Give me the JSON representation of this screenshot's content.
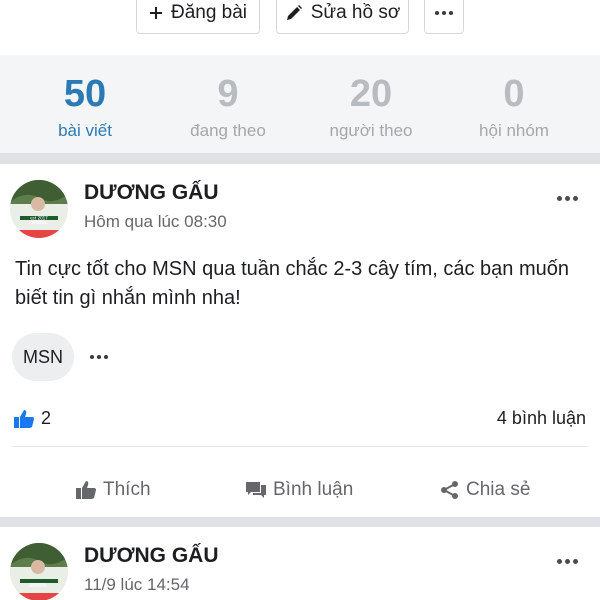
{
  "toolbar": {
    "post_label": "Đăng bài",
    "edit_label": "Sửa hồ sơ"
  },
  "stats": [
    {
      "value": "50",
      "label": "bài viết",
      "active": true
    },
    {
      "value": "9",
      "label": "đang theo",
      "active": false
    },
    {
      "value": "20",
      "label": "người theo",
      "active": false
    },
    {
      "value": "0",
      "label": "hội nhóm",
      "active": false
    }
  ],
  "posts": [
    {
      "author": "DƯƠNG GẤU",
      "time": "Hôm qua lúc 08:30",
      "content": "Tin cực tốt cho MSN qua tuần chắc 2-3 cây tím, các bạn muốn biết tin gì nhắn mình nha!",
      "tag": "MSN",
      "likes": "2",
      "comments": "4 bình luận"
    },
    {
      "author": "DƯƠNG GẤU",
      "time": "11/9 lúc 14:54"
    }
  ],
  "post_actions": {
    "like_label": "Thích",
    "comment_label": "Bình luận",
    "share_label": "Chia sẻ"
  },
  "colors": {
    "accent": "#2a7ab5",
    "like_blue": "#1877f2"
  }
}
